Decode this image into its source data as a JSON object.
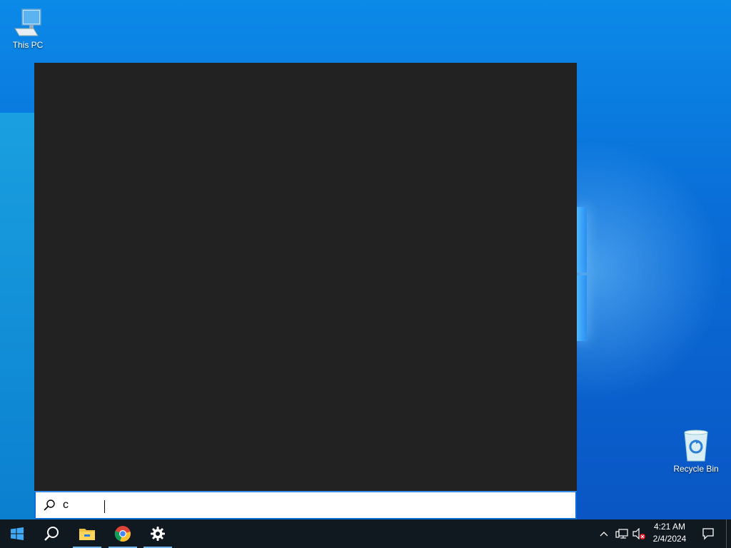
{
  "desktop": {
    "icons": [
      {
        "label": "This PC",
        "icon": "this-pc-icon"
      },
      {
        "label": "Recycle Bin",
        "icon": "recycle-bin-icon"
      }
    ]
  },
  "search": {
    "query": "c",
    "icon": "search-icon"
  },
  "taskbar": {
    "start_icon": "windows-logo-icon",
    "pinned": [
      {
        "name": "search",
        "icon": "search-icon"
      },
      {
        "name": "file-explorer",
        "icon": "folder-icon"
      },
      {
        "name": "chrome",
        "icon": "chrome-icon"
      },
      {
        "name": "settings",
        "icon": "gear-icon"
      }
    ],
    "tray": {
      "chevron_icon": "chevron-up-icon",
      "network_icon": "network-icon",
      "volume_icon": "volume-muted-icon",
      "time": "4:21 AM",
      "date": "2/4/2024",
      "notification_icon": "action-center-icon"
    }
  },
  "colors": {
    "accent": "#0a6ed8",
    "taskbar": "#101820",
    "panel": "#222222"
  }
}
